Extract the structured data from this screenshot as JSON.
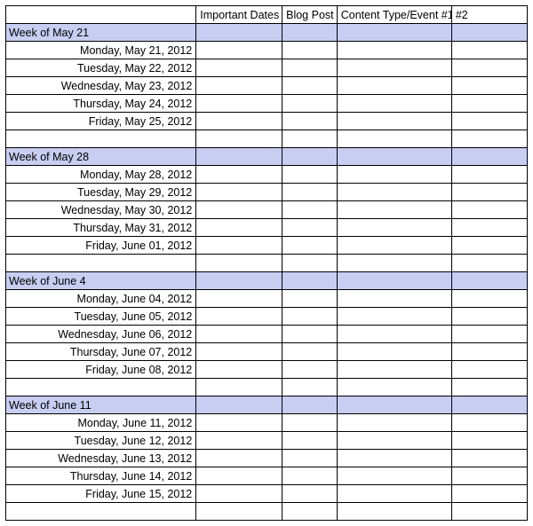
{
  "headers": [
    "",
    "Important Dates",
    "Blog Post",
    "Content Type/Event #1",
    "#2"
  ],
  "weeks": [
    {
      "title": "Week of May 21",
      "days": [
        "Monday, May 21, 2012",
        "Tuesday, May 22, 2012",
        "Wednesday, May 23, 2012",
        "Thursday, May 24, 2012",
        "Friday, May 25, 2012"
      ]
    },
    {
      "title": "Week of May 28",
      "days": [
        "Monday, May 28, 2012",
        "Tuesday, May 29, 2012",
        "Wednesday, May 30, 2012",
        "Thursday, May 31, 2012",
        "Friday, June 01, 2012"
      ]
    },
    {
      "title": "Week of June 4",
      "days": [
        "Monday, June 04, 2012",
        "Tuesday, June 05, 2012",
        "Wednesday, June 06, 2012",
        "Thursday, June 07, 2012",
        "Friday, June 08, 2012"
      ]
    },
    {
      "title": "Week of June 11",
      "days": [
        "Monday, June 11, 2012",
        "Tuesday, June 12, 2012",
        "Wednesday, June 13, 2012",
        "Thursday, June 14, 2012",
        "Friday, June 15, 2012"
      ]
    }
  ]
}
